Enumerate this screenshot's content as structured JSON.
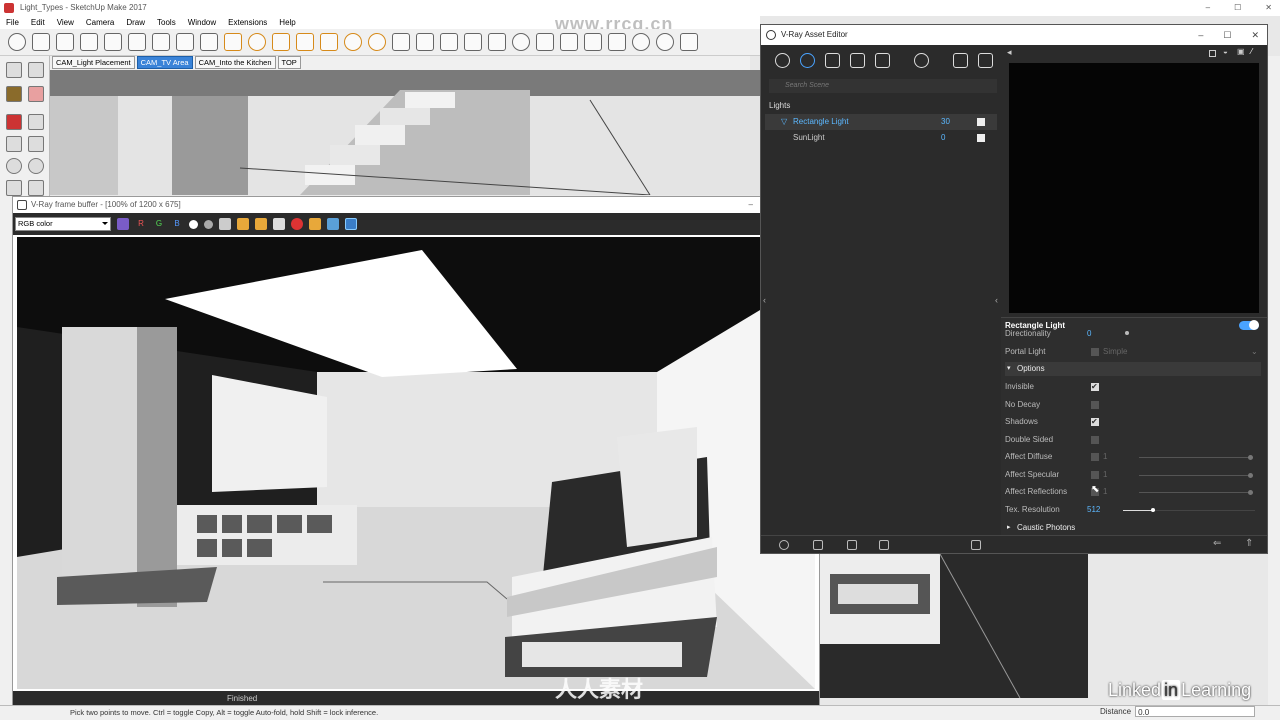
{
  "sketchup": {
    "title": "Light_Types - SketchUp Make 2017",
    "menu": [
      "File",
      "Edit",
      "View",
      "Camera",
      "Draw",
      "Tools",
      "Window",
      "Extensions",
      "Help"
    ],
    "scene_tabs": [
      {
        "label": "CAM_Light Placement",
        "active": false
      },
      {
        "label": "CAM_TV Area",
        "active": true
      },
      {
        "label": "CAM_Into the Kitchen",
        "active": false
      },
      {
        "label": "TOP",
        "active": false
      }
    ],
    "status_text": "Pick two points to move.  Ctrl = toggle Copy, Alt = toggle Auto-fold, hold Shift = lock inference.",
    "distance_label": "Distance",
    "distance_value": "0.0"
  },
  "frame_buffer": {
    "title": "V-Ray frame buffer - [100% of 1200 x 675]",
    "channel_select": "RGB color",
    "channel_buttons": [
      "R",
      "G",
      "B"
    ],
    "status": "Finished"
  },
  "asset_editor": {
    "title": "V-Ray Asset Editor",
    "search_placeholder": "Search Scene",
    "list_heading": "Lights",
    "lights": [
      {
        "name": "Rectangle Light",
        "value": "30",
        "selected": true
      },
      {
        "name": "SunLight",
        "value": "0",
        "selected": false
      }
    ],
    "props_title": "Rectangle Light",
    "directionality_label": "Directionality",
    "directionality_value": "0",
    "portal_light_label": "Portal Light",
    "portal_light_value": "Simple",
    "options_label": "Options",
    "options": [
      {
        "label": "Invisible",
        "checked": true
      },
      {
        "label": "No Decay",
        "checked": false
      },
      {
        "label": "Shadows",
        "checked": true
      },
      {
        "label": "Double Sided",
        "checked": false
      },
      {
        "label": "Affect Diffuse",
        "checked": false,
        "value": "1"
      },
      {
        "label": "Affect Specular",
        "checked": false,
        "value": "1"
      },
      {
        "label": "Affect Reflections",
        "checked": false,
        "value": "1"
      }
    ],
    "tex_resolution_label": "Tex. Resolution",
    "tex_resolution_value": "512",
    "caustic_label": "Caustic Photons"
  },
  "watermarks": {
    "site": "www.rrcg.cn",
    "cn_brand": "人人素材",
    "linkedin_a": "Linked",
    "linkedin_in": "in",
    "linkedin_b": "Learning"
  },
  "colors": {
    "accent": "#3a83d8",
    "vray_blue": "#5cb8ff",
    "dark_panel": "#2b2b2b"
  }
}
